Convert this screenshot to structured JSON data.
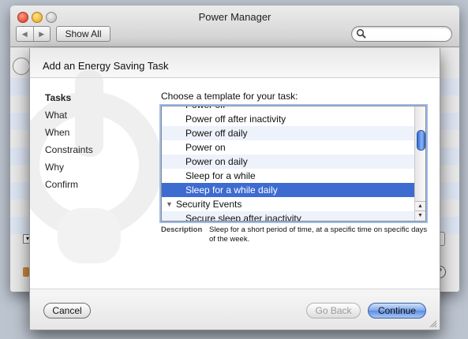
{
  "window": {
    "title": "Power Manager",
    "show_all_label": "Show All",
    "back_arrow": "◀",
    "forward_arrow": "▶",
    "search_placeholder": ""
  },
  "sheet": {
    "title": "Add an Energy Saving Task",
    "steps": [
      "Tasks",
      "What",
      "When",
      "Constraints",
      "Why",
      "Confirm"
    ],
    "active_step": "Tasks",
    "prompt": "Choose a template for your task:",
    "list_items": [
      {
        "label": "Power off",
        "type": "item",
        "partial": true
      },
      {
        "label": "Power off after inactivity",
        "type": "item"
      },
      {
        "label": "Power off daily",
        "type": "item"
      },
      {
        "label": "Power on",
        "type": "item"
      },
      {
        "label": "Power on daily",
        "type": "item"
      },
      {
        "label": "Sleep for a while",
        "type": "item"
      },
      {
        "label": "Sleep for a while daily",
        "type": "item",
        "selected": true
      },
      {
        "label": "Security Events",
        "type": "group",
        "expanded": true
      },
      {
        "label": "Secure sleep after inactivity",
        "type": "item",
        "partial": true
      }
    ],
    "description_label": "Description",
    "description_text": "Sleep for a short period of time, at a specific time on specific days of the week.",
    "cancel_label": "Cancel",
    "back_label": "Go Back",
    "continue_label": "Continue"
  },
  "colors": {
    "selection": "#3d6bd0",
    "alt_row": "#edf2fb",
    "continue_button": "#5c8ddf"
  },
  "icons": {
    "search": "magnifier-icon",
    "group_expanded": "disclosure-triangle-down-icon",
    "scroll_up": "scroll-up-arrow-icon",
    "scroll_down": "scroll-down-arrow-icon"
  }
}
